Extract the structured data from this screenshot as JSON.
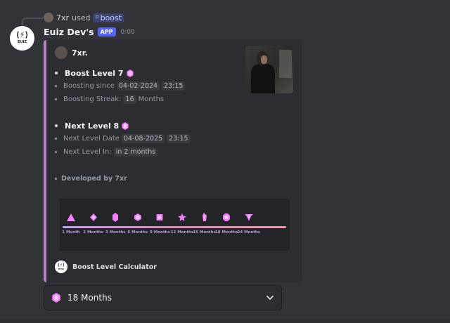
{
  "reply": {
    "user": "7xr",
    "used_text": "used",
    "command": "boost"
  },
  "message": {
    "bot_name": "Euiz Dev's",
    "badge": "APP",
    "time": "0:00"
  },
  "embed": {
    "author": "7xr.",
    "accent": "#b77fc6",
    "boost_level_title": "Boost Level 7",
    "boosting_since_label": "Boosting since",
    "boosting_since_date": "04-02-2024",
    "boosting_since_time": "23:15",
    "streak_label": "Boosting Streak:",
    "streak_value": "16",
    "streak_unit": "Months",
    "next_level_title": "Next Level 8",
    "next_date_label": "Next Level Date",
    "next_date": "04-08-2025",
    "next_time": "23:15",
    "next_in_label": "Next Level In:",
    "next_in_value": "in 2 months",
    "developed_by": "Developed by 7xr",
    "footer": "Boost Level Calculator"
  },
  "levels_chart": {
    "stages": [
      "1 Month",
      "2 Months",
      "3 Months",
      "6 Months",
      "9 Months",
      "12 Months",
      "15 Months",
      "18 Months",
      "24 Months"
    ],
    "icons": [
      "triangle-icon",
      "diamond-icon",
      "hexagon-tall-icon",
      "hexagon-icon",
      "square-icon",
      "star-icon",
      "crystal-icon",
      "octagon-icon",
      "winged-gem-icon"
    ],
    "color": "#f47fff"
  },
  "select": {
    "value": "18 Months",
    "icon": "boost-gem-icon",
    "chevron": "chevron-down-icon"
  },
  "colors": {
    "background": "#313338",
    "embed": "#2b2d31",
    "app_badge": "#5865f2",
    "gem": "#f47fff"
  }
}
